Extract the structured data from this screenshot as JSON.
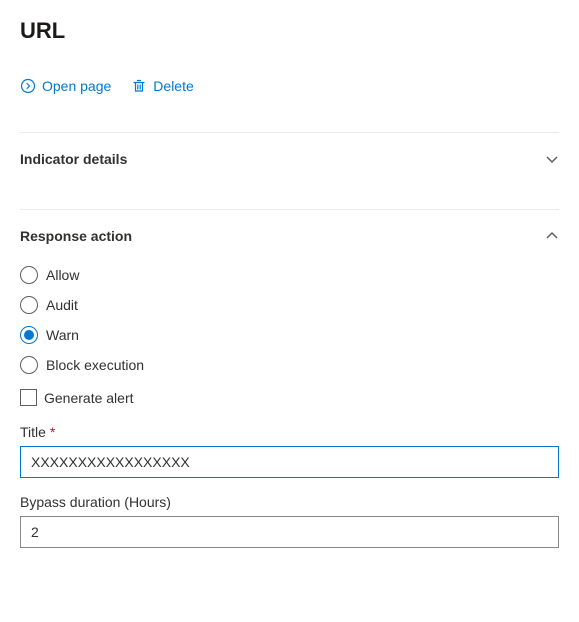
{
  "page": {
    "title": "URL"
  },
  "actions": {
    "open_page": "Open page",
    "delete": "Delete"
  },
  "sections": {
    "indicator_details": {
      "title": "Indicator details",
      "expanded": false
    },
    "response_action": {
      "title": "Response action",
      "expanded": true
    }
  },
  "response_action": {
    "options": {
      "allow": "Allow",
      "audit": "Audit",
      "warn": "Warn",
      "block": "Block execution"
    },
    "selected": "warn",
    "generate_alert": {
      "label": "Generate alert",
      "checked": false
    },
    "title_field": {
      "label": "Title",
      "required_mark": "*",
      "value": "XXXXXXXXXXXXXXXXX"
    },
    "bypass_field": {
      "label": "Bypass duration (Hours)",
      "value": "2"
    }
  }
}
